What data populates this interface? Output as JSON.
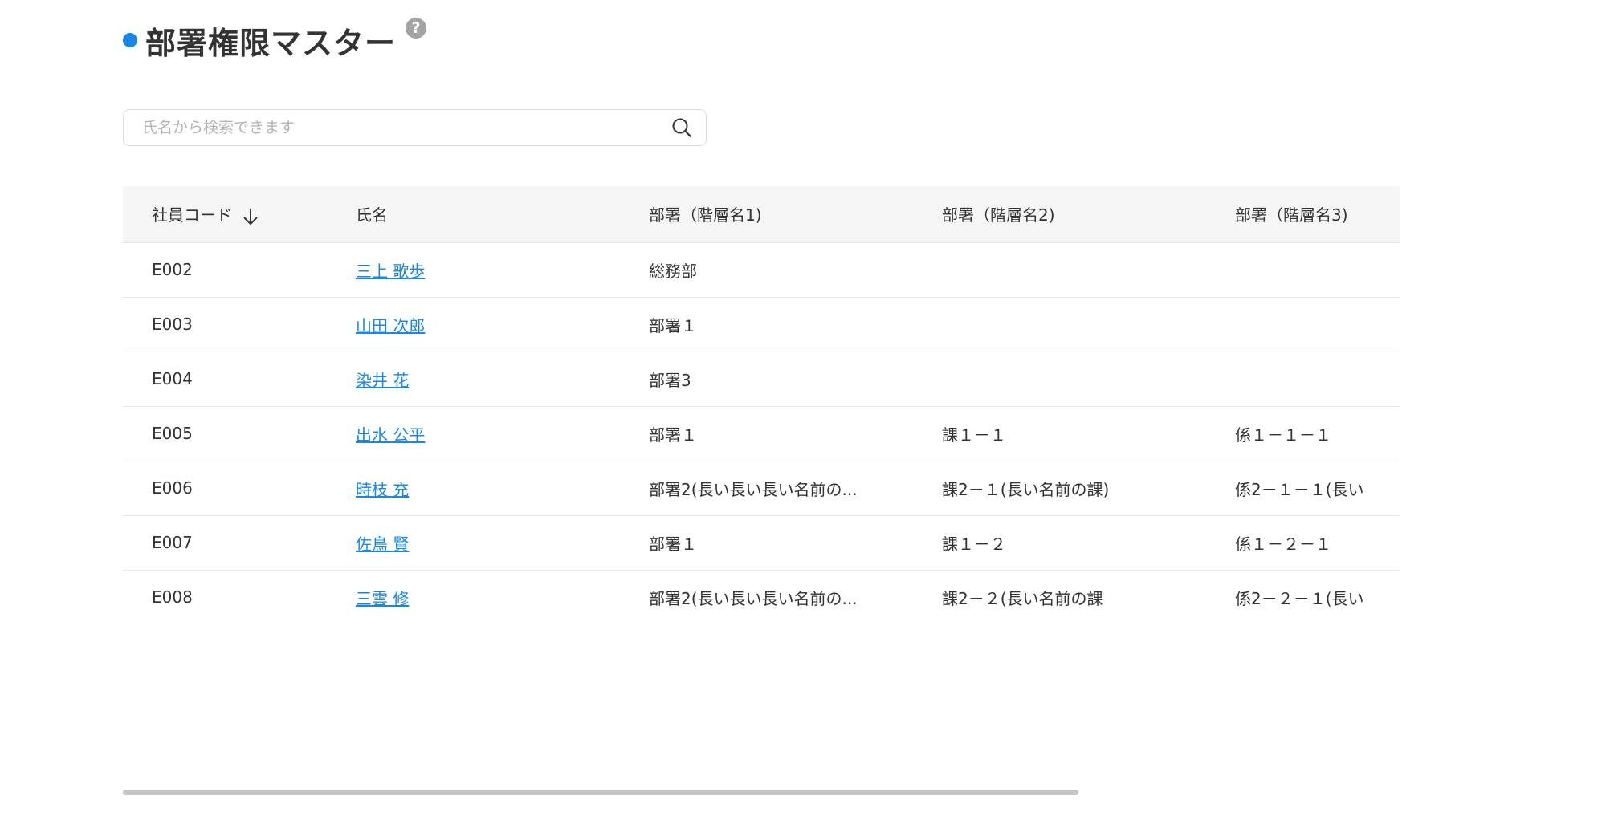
{
  "header": {
    "title": "部署権限マスター",
    "help_glyph": "?",
    "accent_color": "#1a87e6"
  },
  "search": {
    "placeholder": "氏名から検索できます",
    "value": ""
  },
  "table": {
    "columns": [
      "社員コード",
      "氏名",
      "部署（階層名1)",
      "部署（階層名2)",
      "部署（階層名3)"
    ],
    "sort_column": "社員コード",
    "sort_direction": "descending-arrow",
    "rows": [
      {
        "code": "E002",
        "name": "三上 歌歩",
        "dept1": "総務部",
        "dept2": "",
        "dept3": ""
      },
      {
        "code": "E003",
        "name": "山田 次郎",
        "dept1": "部署１",
        "dept2": "",
        "dept3": ""
      },
      {
        "code": "E004",
        "name": "染井 花",
        "dept1": "部署3",
        "dept2": "",
        "dept3": ""
      },
      {
        "code": "E005",
        "name": "出水 公平",
        "dept1": "部署１",
        "dept2": "課１－１",
        "dept3": "係１－１－１"
      },
      {
        "code": "E006",
        "name": "時枝 充",
        "dept1": "部署2(長い長い長い名前の...",
        "dept2": "課2－１(長い名前の課)",
        "dept3": "係2－１－１(長い"
      },
      {
        "code": "E007",
        "name": "佐鳥 賢",
        "dept1": "部署１",
        "dept2": "課１－２",
        "dept3": "係１－２－１"
      },
      {
        "code": "E008",
        "name": "三雲 修",
        "dept1": "部署2(長い長い長い名前の...",
        "dept2": "課2－２(長い名前の課",
        "dept3": "係2－２－１(長い"
      }
    ]
  },
  "icons": {
    "search": "search-icon",
    "sort": "arrow-down-icon",
    "help": "question-circle-icon"
  }
}
